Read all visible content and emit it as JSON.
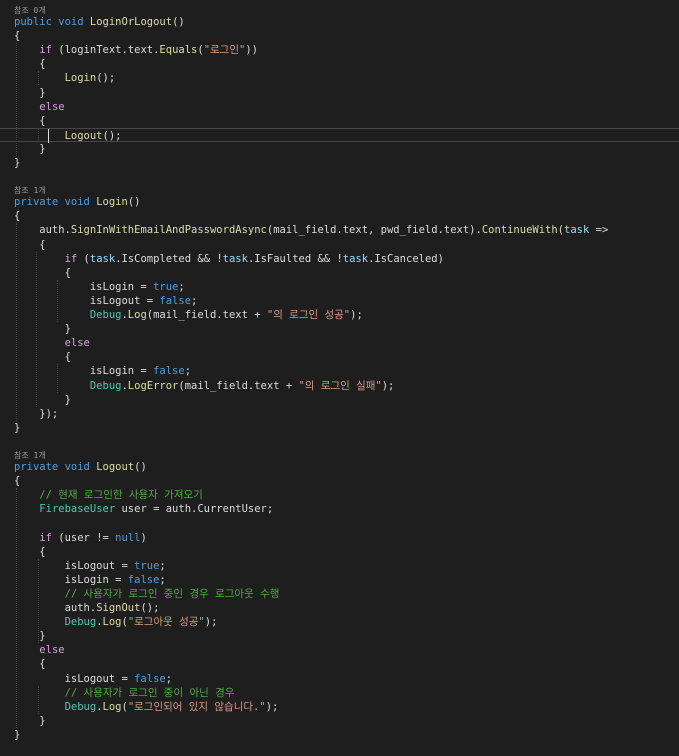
{
  "editor": {
    "current_line": 9,
    "theme": "dark",
    "colors": {
      "background": "#1e1e1e",
      "keyword": "#569cd6",
      "control": "#d8a0df",
      "type": "#4ec9b0",
      "method": "#dcdcaa",
      "string": "#d69d85",
      "comment": "#57a64a",
      "text": "#dcdcdc"
    },
    "codelens": [
      "참조 0개",
      "참조 1개",
      "참조 1개"
    ],
    "lines": [
      {
        "kind": "codelens",
        "text": "참조 0개"
      },
      {
        "kind": "code",
        "tokens": [
          [
            "public",
            "kw"
          ],
          [
            " ",
            "id"
          ],
          [
            "void",
            "kw"
          ],
          [
            " ",
            "id"
          ],
          [
            "LoginOrLogout",
            "fn"
          ],
          [
            "()",
            "id"
          ]
        ]
      },
      {
        "kind": "code",
        "tokens": [
          [
            "{",
            "id"
          ]
        ]
      },
      {
        "kind": "code",
        "tokens": [
          [
            "    ",
            "id"
          ],
          [
            "if",
            "ctl"
          ],
          [
            " (loginText.text.",
            "id"
          ],
          [
            "Equals",
            "fn"
          ],
          [
            "(",
            "id"
          ],
          [
            "\"로그인\"",
            "str"
          ],
          [
            "))",
            "id"
          ]
        ]
      },
      {
        "kind": "code",
        "tokens": [
          [
            "    {",
            "id"
          ]
        ]
      },
      {
        "kind": "code",
        "tokens": [
          [
            "        ",
            "id"
          ],
          [
            "Login",
            "fn"
          ],
          [
            "();",
            "id"
          ]
        ]
      },
      {
        "kind": "code",
        "tokens": [
          [
            "    }",
            "id"
          ]
        ]
      },
      {
        "kind": "code",
        "tokens": [
          [
            "    ",
            "id"
          ],
          [
            "else",
            "ctl"
          ]
        ]
      },
      {
        "kind": "code",
        "tokens": [
          [
            "    {",
            "id"
          ]
        ]
      },
      {
        "kind": "code",
        "tokens": [
          [
            "        ",
            "id"
          ],
          [
            "Logout",
            "fn"
          ],
          [
            "();",
            "id"
          ]
        ]
      },
      {
        "kind": "code",
        "tokens": [
          [
            "    }",
            "id"
          ]
        ]
      },
      {
        "kind": "code",
        "tokens": [
          [
            "}",
            "id"
          ]
        ]
      },
      {
        "kind": "blank"
      },
      {
        "kind": "codelens",
        "text": "참조 1개"
      },
      {
        "kind": "code",
        "tokens": [
          [
            "private",
            "kw"
          ],
          [
            " ",
            "id"
          ],
          [
            "void",
            "kw"
          ],
          [
            " ",
            "id"
          ],
          [
            "Login",
            "fn"
          ],
          [
            "()",
            "id"
          ]
        ]
      },
      {
        "kind": "code",
        "tokens": [
          [
            "{",
            "id"
          ]
        ]
      },
      {
        "kind": "code",
        "tokens": [
          [
            "    auth.",
            "id"
          ],
          [
            "SignInWithEmailAndPasswordAsync",
            "fn"
          ],
          [
            "(mail_field.text, pwd_field.text).",
            "id"
          ],
          [
            "ContinueWith",
            "fn"
          ],
          [
            "(",
            "id"
          ],
          [
            "task",
            "lp"
          ],
          [
            " =>",
            "id"
          ]
        ]
      },
      {
        "kind": "code",
        "tokens": [
          [
            "    {",
            "id"
          ]
        ]
      },
      {
        "kind": "code",
        "tokens": [
          [
            "        ",
            "id"
          ],
          [
            "if",
            "ctl"
          ],
          [
            " (",
            "id"
          ],
          [
            "task",
            "lp"
          ],
          [
            ".IsCompleted && !",
            "id"
          ],
          [
            "task",
            "lp"
          ],
          [
            ".IsFaulted && !",
            "id"
          ],
          [
            "task",
            "lp"
          ],
          [
            ".IsCanceled)",
            "id"
          ]
        ]
      },
      {
        "kind": "code",
        "tokens": [
          [
            "        {",
            "id"
          ]
        ]
      },
      {
        "kind": "code",
        "tokens": [
          [
            "            isLogin = ",
            "id"
          ],
          [
            "true",
            "kw"
          ],
          [
            ";",
            "id"
          ]
        ]
      },
      {
        "kind": "code",
        "tokens": [
          [
            "            isLogout = ",
            "id"
          ],
          [
            "false",
            "kw"
          ],
          [
            ";",
            "id"
          ]
        ]
      },
      {
        "kind": "code",
        "tokens": [
          [
            "            ",
            "id"
          ],
          [
            "Debug",
            "ty"
          ],
          [
            ".",
            "id"
          ],
          [
            "Log",
            "fn"
          ],
          [
            "(mail_field.text + ",
            "id"
          ],
          [
            "\"의 로그인 성공\"",
            "str"
          ],
          [
            ");",
            "id"
          ]
        ]
      },
      {
        "kind": "code",
        "tokens": [
          [
            "        }",
            "id"
          ]
        ]
      },
      {
        "kind": "code",
        "tokens": [
          [
            "        ",
            "id"
          ],
          [
            "else",
            "ctl"
          ]
        ]
      },
      {
        "kind": "code",
        "tokens": [
          [
            "        {",
            "id"
          ]
        ]
      },
      {
        "kind": "code",
        "tokens": [
          [
            "            isLogin = ",
            "id"
          ],
          [
            "false",
            "kw"
          ],
          [
            ";",
            "id"
          ]
        ]
      },
      {
        "kind": "code",
        "tokens": [
          [
            "            ",
            "id"
          ],
          [
            "Debug",
            "ty"
          ],
          [
            ".",
            "id"
          ],
          [
            "LogError",
            "fn"
          ],
          [
            "(mail_field.text + ",
            "id"
          ],
          [
            "\"의 로그인 실패\"",
            "str"
          ],
          [
            ");",
            "id"
          ]
        ]
      },
      {
        "kind": "code",
        "tokens": [
          [
            "        }",
            "id"
          ]
        ]
      },
      {
        "kind": "code",
        "tokens": [
          [
            "    });",
            "id"
          ]
        ]
      },
      {
        "kind": "code",
        "tokens": [
          [
            "}",
            "id"
          ]
        ]
      },
      {
        "kind": "blank"
      },
      {
        "kind": "codelens",
        "text": "참조 1개"
      },
      {
        "kind": "code",
        "tokens": [
          [
            "private",
            "kw"
          ],
          [
            " ",
            "id"
          ],
          [
            "void",
            "kw"
          ],
          [
            " ",
            "id"
          ],
          [
            "Logout",
            "fn"
          ],
          [
            "()",
            "id"
          ]
        ]
      },
      {
        "kind": "code",
        "tokens": [
          [
            "{",
            "id"
          ]
        ]
      },
      {
        "kind": "code",
        "tokens": [
          [
            "    ",
            "id"
          ],
          [
            "// 현재 로그인한 사용자 가져오기",
            "cm"
          ]
        ]
      },
      {
        "kind": "code",
        "tokens": [
          [
            "    ",
            "id"
          ],
          [
            "FirebaseUser",
            "ty"
          ],
          [
            " user = auth.CurrentUser;",
            "id"
          ]
        ]
      },
      {
        "kind": "blank"
      },
      {
        "kind": "code",
        "tokens": [
          [
            "    ",
            "id"
          ],
          [
            "if",
            "ctl"
          ],
          [
            " (user != ",
            "id"
          ],
          [
            "null",
            "kw"
          ],
          [
            ")",
            "id"
          ]
        ]
      },
      {
        "kind": "code",
        "tokens": [
          [
            "    {",
            "id"
          ]
        ]
      },
      {
        "kind": "code",
        "tokens": [
          [
            "        isLogout = ",
            "id"
          ],
          [
            "true",
            "kw"
          ],
          [
            ";",
            "id"
          ]
        ]
      },
      {
        "kind": "code",
        "tokens": [
          [
            "        isLogin = ",
            "id"
          ],
          [
            "false",
            "kw"
          ],
          [
            ";",
            "id"
          ]
        ]
      },
      {
        "kind": "code",
        "tokens": [
          [
            "        ",
            "id"
          ],
          [
            "// 사용자가 로그인 중인 경우 로그아웃 수행",
            "cm"
          ]
        ]
      },
      {
        "kind": "code",
        "tokens": [
          [
            "        auth.",
            "id"
          ],
          [
            "SignOut",
            "fn"
          ],
          [
            "();",
            "id"
          ]
        ]
      },
      {
        "kind": "code",
        "tokens": [
          [
            "        ",
            "id"
          ],
          [
            "Debug",
            "ty"
          ],
          [
            ".",
            "id"
          ],
          [
            "Log",
            "fn"
          ],
          [
            "(",
            "id"
          ],
          [
            "\"로그아웃 성공\"",
            "str"
          ],
          [
            ");",
            "id"
          ]
        ]
      },
      {
        "kind": "code",
        "tokens": [
          [
            "    }",
            "id"
          ]
        ]
      },
      {
        "kind": "code",
        "tokens": [
          [
            "    ",
            "id"
          ],
          [
            "else",
            "ctl"
          ]
        ]
      },
      {
        "kind": "code",
        "tokens": [
          [
            "    {",
            "id"
          ]
        ]
      },
      {
        "kind": "code",
        "tokens": [
          [
            "        isLogout = ",
            "id"
          ],
          [
            "false",
            "kw"
          ],
          [
            ";",
            "id"
          ]
        ]
      },
      {
        "kind": "code",
        "tokens": [
          [
            "        ",
            "id"
          ],
          [
            "// 사용자가 로그인 중이 아닌 경우",
            "cm"
          ]
        ]
      },
      {
        "kind": "code",
        "tokens": [
          [
            "        ",
            "id"
          ],
          [
            "Debug",
            "ty"
          ],
          [
            ".",
            "id"
          ],
          [
            "Log",
            "fn"
          ],
          [
            "(",
            "id"
          ],
          [
            "\"로그인되어 있지 않습니다.\"",
            "str"
          ],
          [
            ");",
            "id"
          ]
        ]
      },
      {
        "kind": "code",
        "tokens": [
          [
            "    }",
            "id"
          ]
        ]
      },
      {
        "kind": "code",
        "tokens": [
          [
            "}",
            "id"
          ]
        ]
      }
    ]
  }
}
